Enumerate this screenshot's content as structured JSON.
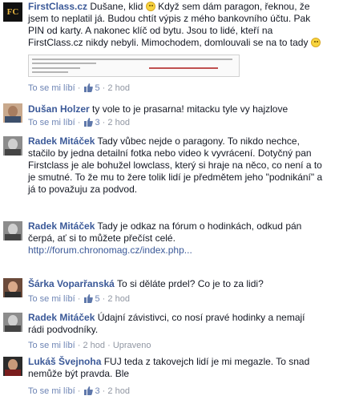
{
  "ui": {
    "like_label": "To se mi líbí",
    "separator": "·"
  },
  "comments": [
    {
      "author": "FirstClass.cz",
      "text_lines": [
        "Dušane, klid",
        "Když sem dám paragon, řeknou, že",
        "jsem to neplatil já. Budou chtít výpis z mého bankovního účtu. Pak",
        "PIN od karty. A nakonec klíč od bytu. Jsou to lidé, kteří na",
        "FirstClass.cz nikdy nebyli. Mimochodem, domlouvali se na to tady"
      ],
      "likes": "5",
      "time": "2 hod",
      "avatar_text": "FC"
    },
    {
      "author": "Dušan Holzer",
      "text": "ty vole to je prasarna! mitacku tyle vy hajzlove",
      "likes": "3",
      "time": "2 hod"
    },
    {
      "author": "Radek Mitáček",
      "text_lines": [
        "Tady vůbec nejde o paragony. To nikdo nechce,",
        "stačilo by jedna detailní fotka nebo video k vyvrácení. Dotyčný pan",
        "Firstclass je ale bohužel lowclass, který si hraje na něco, co není a to",
        "je smutné. To že mu to žere tolik lidí je předmětem jeho \"podnikání\" a",
        "já to považuju za podvod."
      ]
    },
    {
      "author": "Radek Mitáček",
      "text_lines": [
        "Tady je odkaz na fórum o hodinkách, odkud pán",
        "čerpá, ať si to můžete přečíst celé."
      ],
      "link": "http://forum.chronomag.cz/index.php..."
    },
    {
      "author": "Šárka Voparřanská",
      "text": "To si děláte prdel? Co je to za lidi?",
      "likes": "5",
      "time": "2 hod"
    },
    {
      "author": "Radek Mitáček",
      "text_lines": [
        "Údajní závistivci, co nosí pravé hodinky a nemají",
        "rádi podvodníky."
      ],
      "time": "2 hod",
      "edited": "Upraveno"
    },
    {
      "author": "Lukáš Švejnoha",
      "text_lines": [
        "FUJ teda z takovejch lidí je mi megazle. To snad",
        "nemůže být pravda. Ble"
      ],
      "likes": "3",
      "time": "2 hod"
    }
  ],
  "colors": {
    "name": "#3b5998",
    "meta": "#9197a3",
    "text": "#141823"
  }
}
